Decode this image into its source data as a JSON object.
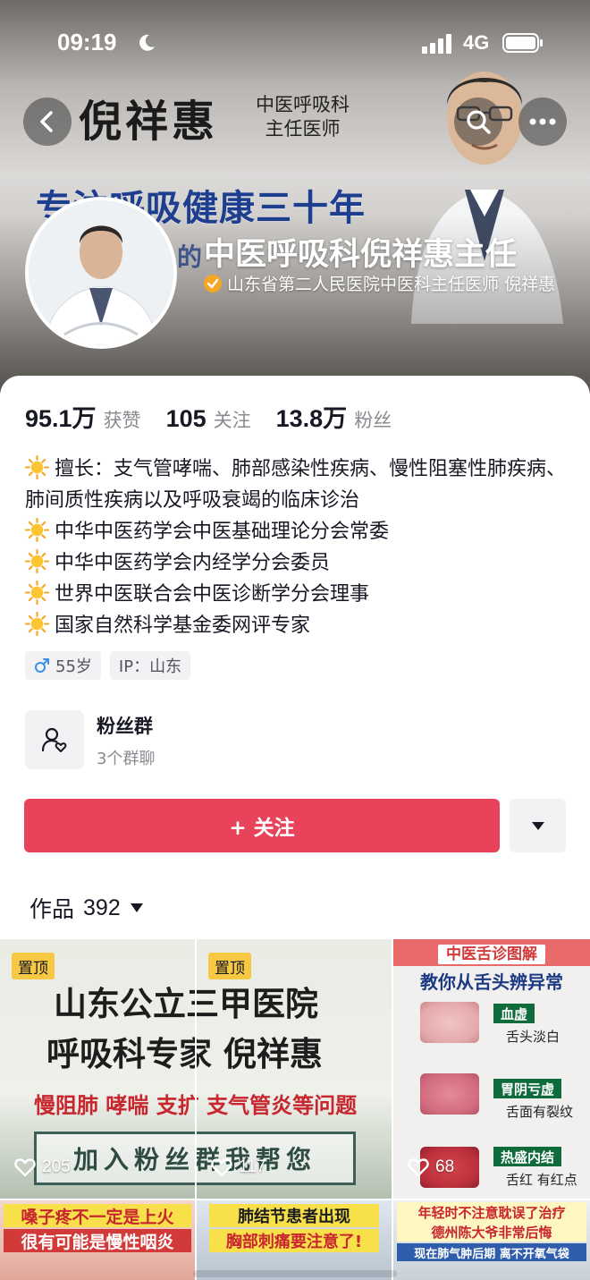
{
  "status_bar": {
    "time": "09:19",
    "network": "4G"
  },
  "banner": {
    "name": "倪祥惠",
    "dept_line1": "中医呼吸科",
    "dept_line2": "主任医师",
    "slogan": "专注呼吸健康三十年",
    "slogan2": "的"
  },
  "profile": {
    "name": "中医呼吸科倪祥惠主任",
    "verification": "山东省第二人民医院中医科主任医师 倪祥惠"
  },
  "stats": [
    {
      "value": "95.1万",
      "label": "获赞"
    },
    {
      "value": "105",
      "label": "关注"
    },
    {
      "value": "13.8万",
      "label": "粉丝"
    }
  ],
  "bio": [
    "擅长：支气管哮喘、肺部感染性疾病、慢性阻塞性肺疾病、肺间质性疾病以及呼吸衰竭的临床诊治",
    "中华中医药学会中医基础理论分会常委",
    "中华中医药学会内经学分会委员",
    "世界中医联合会中医诊断学分会理事",
    "国家自然科学基金委网评专家"
  ],
  "tags": {
    "age": "55岁",
    "ip": "IP：山东"
  },
  "fan_group": {
    "title": "粉丝群",
    "subtitle": "3个群聊"
  },
  "follow_label": "+ 关注",
  "works": {
    "label": "作品",
    "count": "392"
  },
  "videos": [
    {
      "pinned": "置顶",
      "likes": "205",
      "title1": "山东公立三甲医院",
      "title2": "呼吸科专家 倪祥惠",
      "red": "慢阻肺 哮喘 支扩 支气管炎等问题",
      "join": "加入粉丝群我帮您"
    },
    {
      "pinned": "置顶",
      "likes": "117"
    },
    {
      "likes": "68",
      "header": "中医舌诊图解",
      "title": "教你从舌头辨异常",
      "items": [
        {
          "tag": "血虚",
          "caption": "舌头淡白"
        },
        {
          "tag": "胃阴亏虚",
          "caption": "舌面有裂纹"
        },
        {
          "tag": "热盛内结",
          "caption": "舌红 有红点"
        }
      ]
    },
    {
      "line1": "嗓子疼不一定是上火",
      "line2": "很有可能是慢性咽炎"
    },
    {
      "line1": "肺结节患者出现",
      "line2": "胸部刺痛要注意了!"
    },
    {
      "line1": "年轻时不注意耽误了治疗",
      "line2": "德州陈大爷非常后悔",
      "line3": "现在肺气肿后期 离不开氧气袋"
    }
  ],
  "colors": {
    "follow": "#e8435a",
    "pin": "#f7c844",
    "verify": "#f5a623"
  }
}
